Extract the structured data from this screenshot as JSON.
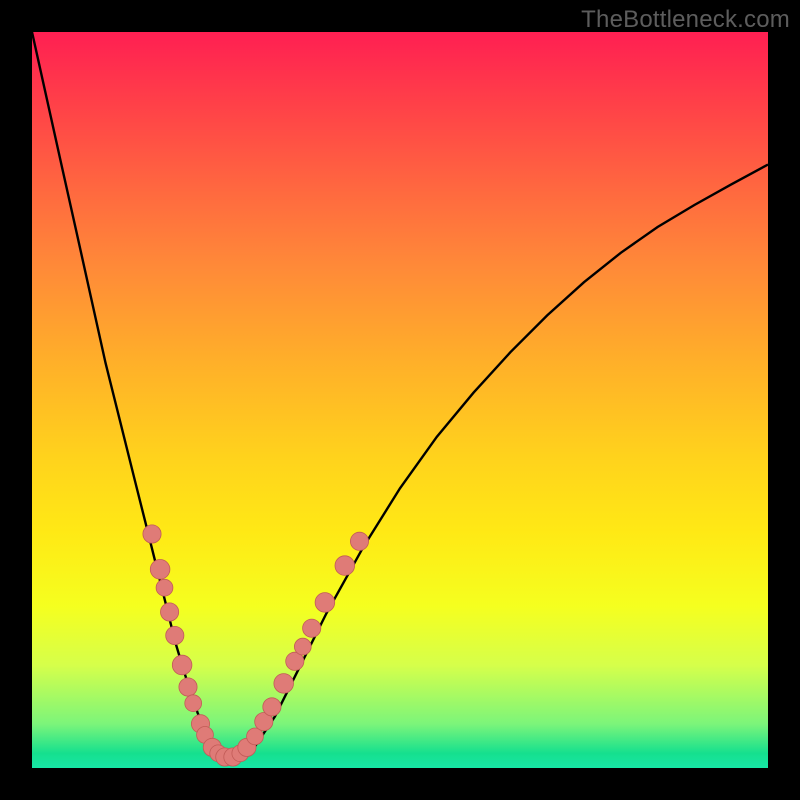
{
  "watermark": "TheBottleneck.com",
  "colors": {
    "frame": "#000000",
    "gradient_top": "#ff1f52",
    "gradient_bottom": "#17e6a6",
    "curve": "#000000",
    "marker_fill": "#df7b77",
    "marker_stroke": "#c25b57"
  },
  "chart_data": {
    "type": "line",
    "title": "",
    "xlabel": "",
    "ylabel": "",
    "xlim": [
      0,
      100
    ],
    "ylim": [
      0,
      100
    ],
    "series": [
      {
        "name": "curve",
        "x": [
          0,
          2,
          4,
          6,
          8,
          10,
          12,
          14,
          16,
          18,
          19.5,
          21,
          22.5,
          24,
          25,
          26,
          27,
          28,
          30,
          33,
          36,
          40,
          45,
          50,
          55,
          60,
          65,
          70,
          75,
          80,
          85,
          90,
          95,
          100
        ],
        "y": [
          100,
          91,
          82,
          73,
          64,
          55,
          47,
          39,
          31,
          23,
          17,
          12,
          7.5,
          4,
          2.2,
          1.2,
          1.0,
          1.2,
          2.5,
          7,
          13,
          21,
          30,
          38,
          45,
          51,
          56.5,
          61.5,
          66,
          70,
          73.5,
          76.5,
          79.3,
          82
        ]
      }
    ],
    "markers": [
      {
        "x": 16.3,
        "y": 31.8,
        "r": 1.3
      },
      {
        "x": 17.4,
        "y": 27.0,
        "r": 1.4
      },
      {
        "x": 18.0,
        "y": 24.5,
        "r": 1.2
      },
      {
        "x": 18.7,
        "y": 21.2,
        "r": 1.3
      },
      {
        "x": 19.4,
        "y": 18.0,
        "r": 1.3
      },
      {
        "x": 20.4,
        "y": 14.0,
        "r": 1.4
      },
      {
        "x": 21.2,
        "y": 11.0,
        "r": 1.3
      },
      {
        "x": 21.9,
        "y": 8.8,
        "r": 1.2
      },
      {
        "x": 22.9,
        "y": 6.0,
        "r": 1.3
      },
      {
        "x": 23.5,
        "y": 4.5,
        "r": 1.2
      },
      {
        "x": 24.5,
        "y": 2.8,
        "r": 1.3
      },
      {
        "x": 25.3,
        "y": 2.0,
        "r": 1.2
      },
      {
        "x": 26.2,
        "y": 1.5,
        "r": 1.3
      },
      {
        "x": 27.3,
        "y": 1.5,
        "r": 1.3
      },
      {
        "x": 28.3,
        "y": 2.0,
        "r": 1.2
      },
      {
        "x": 29.2,
        "y": 2.8,
        "r": 1.3
      },
      {
        "x": 30.3,
        "y": 4.3,
        "r": 1.2
      },
      {
        "x": 31.5,
        "y": 6.3,
        "r": 1.3
      },
      {
        "x": 32.6,
        "y": 8.3,
        "r": 1.3
      },
      {
        "x": 34.2,
        "y": 11.5,
        "r": 1.4
      },
      {
        "x": 35.7,
        "y": 14.5,
        "r": 1.3
      },
      {
        "x": 36.8,
        "y": 16.5,
        "r": 1.2
      },
      {
        "x": 38.0,
        "y": 19.0,
        "r": 1.3
      },
      {
        "x": 39.8,
        "y": 22.5,
        "r": 1.4
      },
      {
        "x": 42.5,
        "y": 27.5,
        "r": 1.4
      },
      {
        "x": 44.5,
        "y": 30.8,
        "r": 1.3
      }
    ]
  }
}
